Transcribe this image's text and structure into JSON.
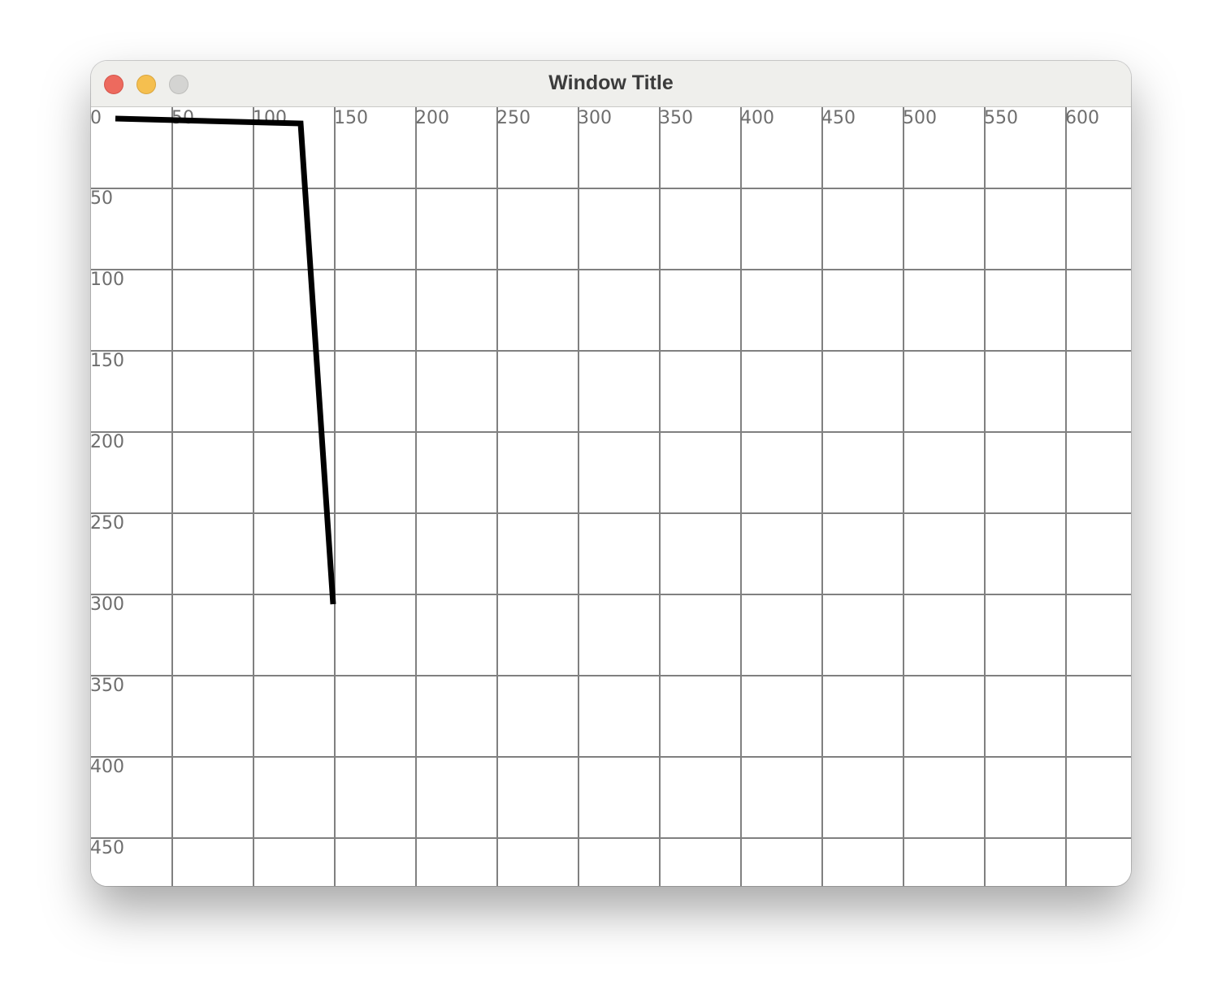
{
  "window": {
    "title": "Window Title",
    "buttons": {
      "close_color": "#ed6a5e",
      "minimize_color": "#f5bf4f",
      "zoom_color": "#d4d4d2"
    }
  },
  "canvas": {
    "grid_color": "#808080",
    "line_color": "#000000"
  },
  "chart_data": {
    "type": "line",
    "title": "",
    "xlabel": "",
    "ylabel": "",
    "grid": true,
    "xlim": [
      0,
      640
    ],
    "ylim": [
      0,
      480
    ],
    "y_axis_inverted": true,
    "x_ticks": [
      0,
      50,
      100,
      150,
      200,
      250,
      300,
      350,
      400,
      450,
      500,
      550,
      600
    ],
    "x_tick_labels": [
      "0",
      "50",
      "100",
      "150",
      "200",
      "250",
      "300",
      "350",
      "400",
      "450",
      "500",
      "550",
      "600"
    ],
    "y_ticks": [
      50,
      100,
      150,
      200,
      250,
      300,
      350,
      400,
      450
    ],
    "y_tick_labels": [
      "50",
      "100",
      "150",
      "200",
      "250",
      "300",
      "350",
      "400",
      "450"
    ],
    "series": [
      {
        "points": [
          [
            15,
            7
          ],
          [
            129,
            10
          ],
          [
            149,
            306
          ],
          [
            149,
            306
          ],
          [
            149,
            306
          ],
          [
            149,
            306
          ],
          [
            149,
            306
          ],
          [
            149,
            306
          ],
          [
            149,
            306
          ],
          [
            149,
            306
          ],
          [
            149,
            306
          ],
          [
            149,
            306
          ],
          [
            149,
            306
          ],
          [
            149,
            306
          ],
          [
            149,
            306
          ],
          [
            149,
            306
          ],
          [
            149,
            306
          ],
          [
            149,
            306
          ],
          [
            149,
            306
          ],
          [
            149,
            306
          ],
          [
            149,
            306
          ],
          [
            149,
            306
          ],
          [
            149,
            306
          ],
          [
            149,
            306
          ],
          [
            149,
            306
          ],
          [
            149,
            306
          ],
          [
            149,
            306
          ],
          [
            149,
            306
          ],
          [
            149,
            306
          ],
          [
            149,
            306
          ],
          [
            149,
            306
          ],
          [
            149,
            306
          ],
          [
            149,
            306
          ],
          [
            149,
            306
          ],
          [
            149,
            306
          ],
          [
            149,
            306
          ],
          [
            149,
            306
          ],
          [
            149,
            306
          ],
          [
            149,
            306
          ],
          [
            149,
            306
          ],
          [
            149,
            306
          ],
          [
            149,
            306
          ],
          [
            149,
            306
          ],
          [
            149,
            306
          ],
          [
            149,
            306
          ],
          [
            149,
            306
          ],
          [
            149,
            306
          ],
          [
            149,
            306
          ],
          [
            149,
            306
          ],
          [
            149,
            306
          ],
          [
            149,
            306
          ],
          [
            149,
            306
          ],
          [
            149,
            306
          ],
          [
            149,
            306
          ],
          [
            149,
            306
          ],
          [
            149,
            306
          ],
          [
            149,
            306
          ],
          [
            149,
            306
          ],
          [
            149,
            306
          ],
          [
            149,
            306
          ],
          [
            149,
            306
          ],
          [
            149,
            306
          ],
          [
            149,
            306
          ],
          [
            149,
            306
          ],
          [
            149,
            306
          ],
          [
            149,
            306
          ],
          [
            149,
            306
          ],
          [
            149,
            306
          ],
          [
            149,
            306
          ],
          [
            149,
            306
          ],
          [
            149,
            306
          ],
          [
            149,
            306
          ],
          [
            149,
            306
          ],
          [
            149,
            306
          ],
          [
            149,
            306
          ],
          [
            149,
            306
          ],
          [
            149,
            306
          ],
          [
            149,
            306
          ],
          [
            149,
            306
          ],
          [
            149,
            306
          ],
          [
            149,
            306
          ],
          [
            149,
            306
          ],
          [
            149,
            306
          ],
          [
            149,
            306
          ],
          [
            149,
            306
          ],
          [
            149,
            306
          ],
          [
            149,
            306
          ],
          [
            149,
            306
          ],
          [
            149,
            306
          ],
          [
            149,
            306
          ],
          [
            149,
            306
          ],
          [
            149,
            306
          ],
          [
            149,
            306
          ],
          [
            149,
            306
          ],
          [
            149,
            306
          ],
          [
            149,
            306
          ],
          [
            149,
            306
          ],
          [
            149,
            306
          ],
          [
            149,
            306
          ],
          [
            149,
            306
          ],
          [
            149,
            306
          ],
          [
            149,
            306
          ],
          [
            149,
            306
          ],
          [
            149,
            306
          ],
          [
            149,
            306
          ],
          [
            149,
            306
          ],
          [
            149,
            306
          ],
          [
            149,
            306
          ],
          [
            149,
            306
          ],
          [
            149,
            306
          ],
          [
            149,
            306
          ],
          [
            149,
            306
          ],
          [
            149,
            306
          ],
          [
            149,
            306
          ],
          [
            149,
            306
          ],
          [
            149,
            306
          ],
          [
            149,
            306
          ]
        ]
      }
    ]
  }
}
